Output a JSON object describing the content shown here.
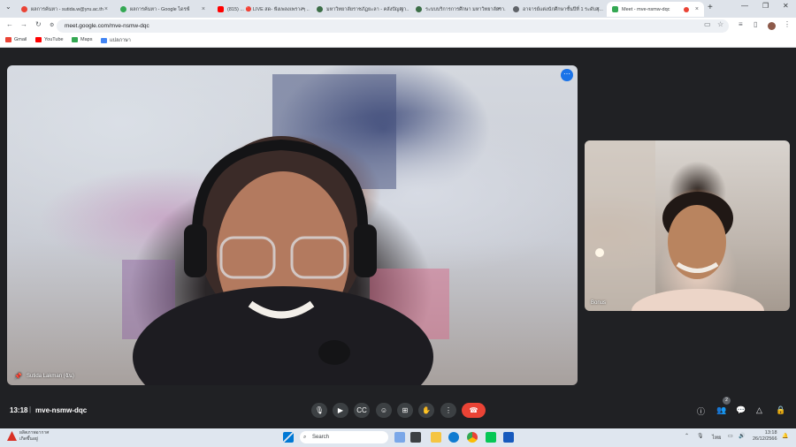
{
  "browser": {
    "tabs": [
      {
        "title": "ผลการค้นหา - sutida.w@yru.ac.th",
        "color": "#ea4335"
      },
      {
        "title": "ผลการค้นหา - Google ไดรฟ์",
        "color": "#34a853"
      },
      {
        "title": "(815) ... 🔴 LIVE สด- ฟังเพลงเพราะๆ ...",
        "color": "#ff0000"
      },
      {
        "title": "มหาวิทยาลัยราชภัฏยะลา - คลังปัญญา...",
        "color": "#3c6e47"
      },
      {
        "title": "ระบบบริการการศึกษา มหาวิทยาลัยรา...",
        "color": "#3c6e47"
      },
      {
        "title": "อาจารย์แต่งนักศึกษาชั้นปีที่ 1 ระดับอุ...",
        "color": "#5f6368"
      },
      {
        "title": "Meet - mve-nsmw-dqc",
        "color": "#34a853"
      }
    ],
    "url": "meet.google.com/mve-nsmw-dqc",
    "bookmarks": [
      {
        "label": "Gmail",
        "color": "#ea4335"
      },
      {
        "label": "YouTube",
        "color": "#ff0000"
      },
      {
        "label": "Maps",
        "color": "#34a853"
      },
      {
        "label": "แปลภาษา",
        "color": "#4285f4"
      }
    ]
  },
  "meet": {
    "main_participant": "Sutida Lakman (ฉัน)",
    "side_participant": "Bonus",
    "time": "13:18",
    "separator": "|",
    "code": "mve-nsmw-dqc",
    "people_count": "2",
    "more_icon": "⋯"
  },
  "taskbar": {
    "weather_line1": "ผลิตภาพอากาศ",
    "weather_line2": "เกิดขึ้นอยู่",
    "search_placeholder": "Search",
    "language": "ไทย",
    "clock_time": "13:18",
    "clock_date": "26/12/2566"
  }
}
